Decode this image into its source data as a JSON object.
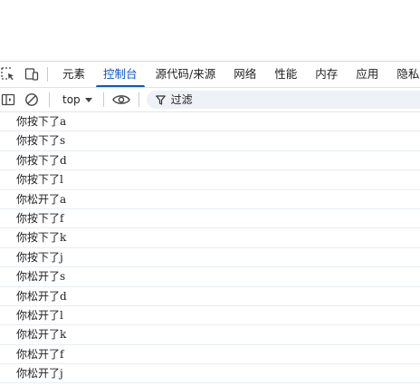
{
  "devtools": {
    "tabs": [
      {
        "label": "元素",
        "active": false
      },
      {
        "label": "控制台",
        "active": true
      },
      {
        "label": "源代码/来源",
        "active": false
      },
      {
        "label": "网络",
        "active": false
      },
      {
        "label": "性能",
        "active": false
      },
      {
        "label": "内存",
        "active": false
      },
      {
        "label": "应用",
        "active": false
      },
      {
        "label": "隐私与",
        "active": false
      }
    ],
    "toolbar": {
      "context": "top",
      "filter_placeholder": "过滤"
    },
    "console_messages": [
      "你按下了a",
      "你按下了s",
      "你按下了d",
      "你按下了l",
      "你松开了a",
      "你按下了f",
      "你按下了k",
      "你按下了j",
      "你松开了s",
      "你松开了d",
      "你松开了l",
      "你松开了k",
      "你松开了f",
      "你松开了j"
    ],
    "colors": {
      "accent": "#0b57d0",
      "text": "#1f1f1f",
      "row_border": "#e6edf3",
      "filter_bg": "#eef1f6"
    }
  }
}
